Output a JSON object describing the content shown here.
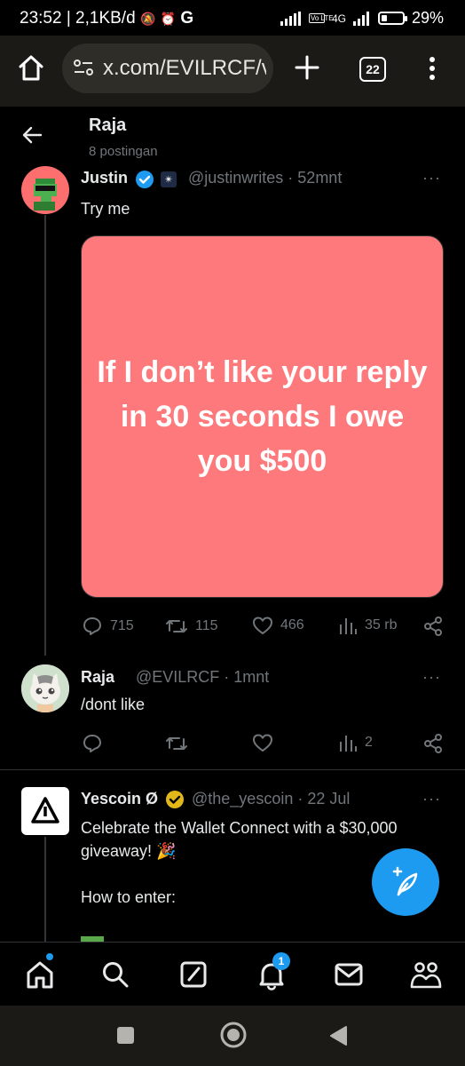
{
  "status_bar": {
    "time_speed": "23:52 | 2,1KB/d",
    "g_label": "G",
    "network": "4G",
    "volte": "Vo LTE",
    "battery_percent": "29%",
    "battery_level": 0.29
  },
  "browser": {
    "url": "x.com/EVILRCF/v",
    "tab_count": "22"
  },
  "header": {
    "title": "Raja",
    "subtitle": "8 postingan"
  },
  "posts": [
    {
      "name": "Justin",
      "handle": "@justinwrites · 52mnt",
      "text": "Try me",
      "media_text": "If I don’t like your reply in 30 seconds I owe you $500",
      "media_color": "#fd797b",
      "replies": "715",
      "reposts": "115",
      "likes": "466",
      "views": "35 rb",
      "more": "···"
    },
    {
      "name": "Raja",
      "handle": "@EVILRCF · 1mnt",
      "text": "/dont like",
      "views": "2",
      "more": "···"
    },
    {
      "name": "Yescoin Ø",
      "handle": "@the_yescoin · 22 Jul",
      "text_line1": "Celebrate the Wallet Connect with a $30,000",
      "text_line2": "giveaway! 🎉",
      "text_line3": "How to enter:",
      "more": "···"
    }
  ],
  "bottom_nav": {
    "notifications_badge": "1",
    "accent": "#1d9bf0"
  }
}
